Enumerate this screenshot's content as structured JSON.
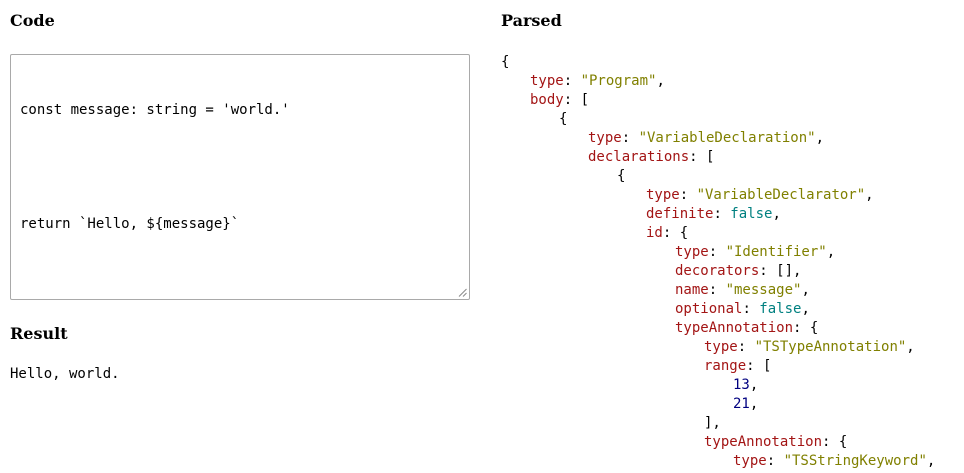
{
  "code_section": {
    "heading": "Code",
    "lines": [
      "const message: string = 'world.'",
      "",
      "return `Hello, ${message}`"
    ]
  },
  "result_section": {
    "heading": "Result",
    "output": "Hello, world."
  },
  "parsed_section": {
    "heading": "Parsed",
    "lines": [
      {
        "indent": 0,
        "parts": [
          [
            "p",
            "{"
          ]
        ]
      },
      {
        "indent": 1,
        "parts": [
          [
            "k",
            "type"
          ],
          [
            "p",
            ": "
          ],
          [
            "s",
            "\"Program\""
          ],
          [
            "p",
            ","
          ]
        ]
      },
      {
        "indent": 1,
        "parts": [
          [
            "k",
            "body"
          ],
          [
            "p",
            ": ["
          ]
        ]
      },
      {
        "indent": 2,
        "parts": [
          [
            "p",
            "{"
          ]
        ]
      },
      {
        "indent": 3,
        "parts": [
          [
            "k",
            "type"
          ],
          [
            "p",
            ": "
          ],
          [
            "s",
            "\"VariableDeclaration\""
          ],
          [
            "p",
            ","
          ]
        ]
      },
      {
        "indent": 3,
        "parts": [
          [
            "k",
            "declarations"
          ],
          [
            "p",
            ": ["
          ]
        ]
      },
      {
        "indent": 4,
        "parts": [
          [
            "p",
            "{"
          ]
        ]
      },
      {
        "indent": 5,
        "parts": [
          [
            "k",
            "type"
          ],
          [
            "p",
            ": "
          ],
          [
            "s",
            "\"VariableDeclarator\""
          ],
          [
            "p",
            ","
          ]
        ]
      },
      {
        "indent": 5,
        "parts": [
          [
            "k",
            "definite"
          ],
          [
            "p",
            ": "
          ],
          [
            "b",
            "false"
          ],
          [
            "p",
            ","
          ]
        ]
      },
      {
        "indent": 5,
        "parts": [
          [
            "k",
            "id"
          ],
          [
            "p",
            ": {"
          ]
        ]
      },
      {
        "indent": 6,
        "parts": [
          [
            "k",
            "type"
          ],
          [
            "p",
            ": "
          ],
          [
            "s",
            "\"Identifier\""
          ],
          [
            "p",
            ","
          ]
        ]
      },
      {
        "indent": 6,
        "parts": [
          [
            "k",
            "decorators"
          ],
          [
            "p",
            ": [],"
          ]
        ]
      },
      {
        "indent": 6,
        "parts": [
          [
            "k",
            "name"
          ],
          [
            "p",
            ": "
          ],
          [
            "s",
            "\"message\""
          ],
          [
            "p",
            ","
          ]
        ]
      },
      {
        "indent": 6,
        "parts": [
          [
            "k",
            "optional"
          ],
          [
            "p",
            ": "
          ],
          [
            "b",
            "false"
          ],
          [
            "p",
            ","
          ]
        ]
      },
      {
        "indent": 6,
        "parts": [
          [
            "k",
            "typeAnnotation"
          ],
          [
            "p",
            ": {"
          ]
        ]
      },
      {
        "indent": 7,
        "parts": [
          [
            "k",
            "type"
          ],
          [
            "p",
            ": "
          ],
          [
            "s",
            "\"TSTypeAnnotation\""
          ],
          [
            "p",
            ","
          ]
        ]
      },
      {
        "indent": 7,
        "parts": [
          [
            "k",
            "range"
          ],
          [
            "p",
            ": ["
          ]
        ]
      },
      {
        "indent": 8,
        "parts": [
          [
            "n",
            "13"
          ],
          [
            "p",
            ","
          ]
        ]
      },
      {
        "indent": 8,
        "parts": [
          [
            "n",
            "21"
          ],
          [
            "p",
            ","
          ]
        ]
      },
      {
        "indent": 7,
        "parts": [
          [
            "p",
            "],"
          ]
        ]
      },
      {
        "indent": 7,
        "parts": [
          [
            "k",
            "typeAnnotation"
          ],
          [
            "p",
            ": {"
          ]
        ]
      },
      {
        "indent": 8,
        "parts": [
          [
            "k",
            "type"
          ],
          [
            "p",
            ": "
          ],
          [
            "s",
            "\"TSStringKeyword\""
          ],
          [
            "p",
            ","
          ]
        ]
      }
    ]
  },
  "colors": {
    "key": "#a31515",
    "string": "#808000",
    "boolean": "#008080",
    "number": "#000080",
    "border": "#a9a9a9"
  }
}
